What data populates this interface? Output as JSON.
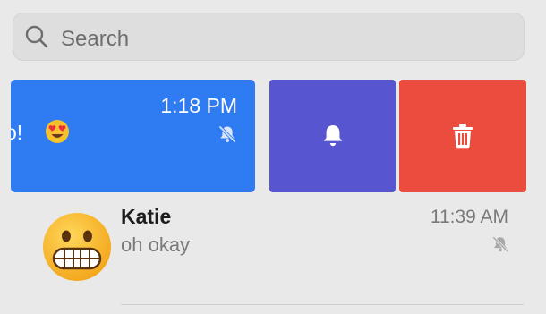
{
  "search": {
    "placeholder": "Search",
    "icon": "search-icon"
  },
  "swiped_conversation": {
    "time": "1:18 PM",
    "preview_fragment": "o!",
    "emoji": "heart-eyes-emoji",
    "muted_icon": "bell-slash-icon"
  },
  "actions": {
    "notifications": {
      "icon": "bell-icon",
      "color": "#5755d0"
    },
    "delete": {
      "icon": "trash-icon",
      "color": "#eb4c3e"
    }
  },
  "conversation": {
    "name": "Katie",
    "time": "11:39 AM",
    "preview": "oh okay",
    "avatar": "grimacing-emoji",
    "muted_icon": "bell-slash-icon"
  },
  "colors": {
    "selected_row": "#2f7bf2",
    "background": "#e9e9e9"
  }
}
